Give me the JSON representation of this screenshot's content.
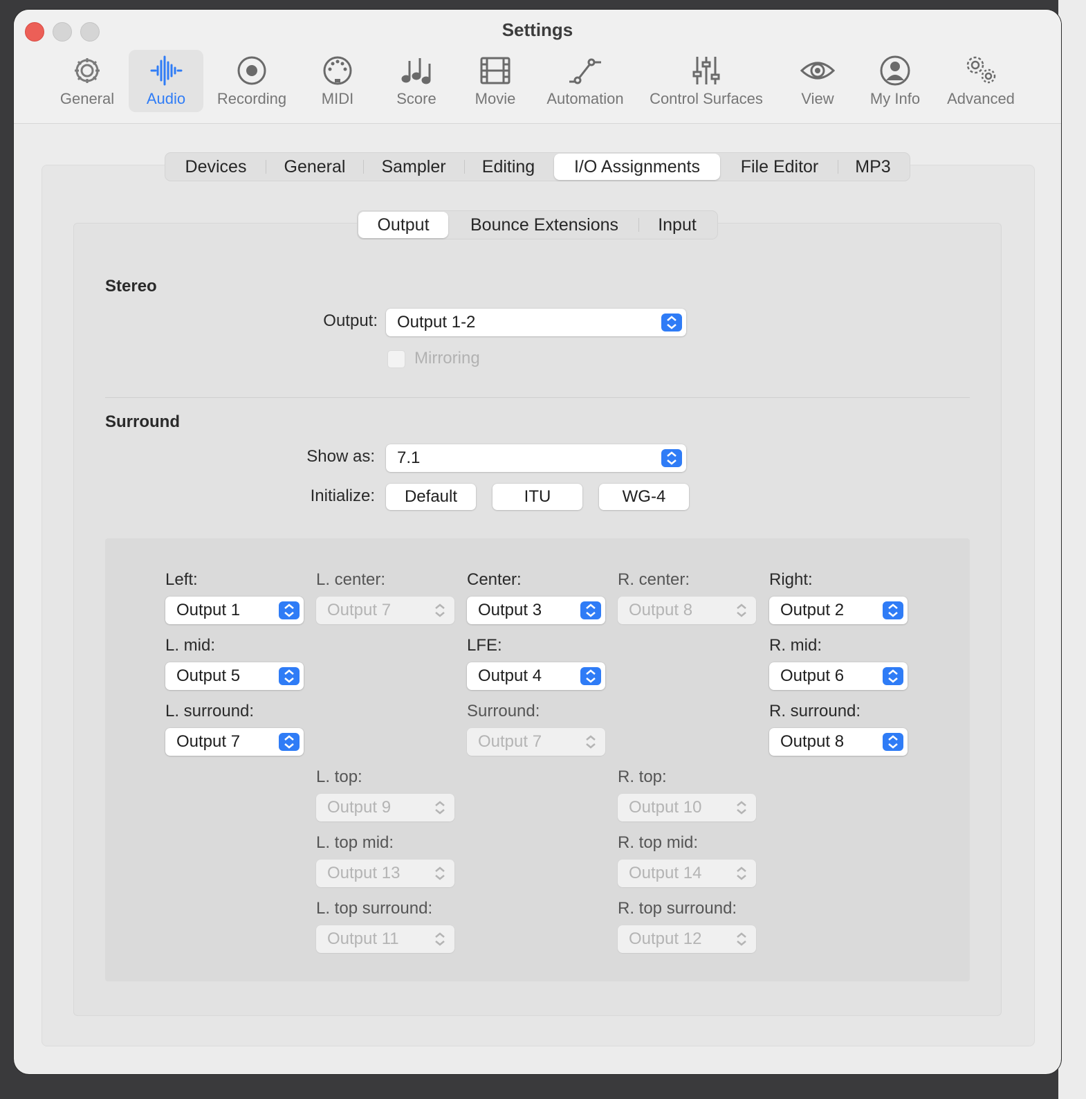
{
  "window": {
    "title": "Settings"
  },
  "toolbar": {
    "items": [
      {
        "label": "General",
        "icon": "gear-icon",
        "active": false
      },
      {
        "label": "Audio",
        "icon": "audio-waveform-icon",
        "active": true
      },
      {
        "label": "Recording",
        "icon": "record-icon",
        "active": false
      },
      {
        "label": "MIDI",
        "icon": "midi-connector-icon",
        "active": false
      },
      {
        "label": "Score",
        "icon": "music-notes-icon",
        "active": false
      },
      {
        "label": "Movie",
        "icon": "film-strip-icon",
        "active": false
      },
      {
        "label": "Automation",
        "icon": "automation-curve-icon",
        "active": false
      },
      {
        "label": "Control Surfaces",
        "icon": "faders-icon",
        "active": false
      },
      {
        "label": "View",
        "icon": "eye-icon",
        "active": false
      },
      {
        "label": "My Info",
        "icon": "person-icon",
        "active": false
      },
      {
        "label": "Advanced",
        "icon": "gears-icon",
        "active": false
      }
    ]
  },
  "tabs": [
    "Devices",
    "General",
    "Sampler",
    "Editing",
    "I/O Assignments",
    "File Editor",
    "MP3"
  ],
  "selected_tab": "I/O Assignments",
  "subtabs": [
    "Output",
    "Bounce Extensions",
    "Input"
  ],
  "selected_subtab": "Output",
  "stereo": {
    "title": "Stereo",
    "output_label": "Output:",
    "output_value": "Output 1-2",
    "mirroring_label": "Mirroring",
    "mirroring_checked": false,
    "mirroring_enabled": false
  },
  "surround": {
    "title": "Surround",
    "show_as_label": "Show as:",
    "show_as_value": "7.1",
    "initialize_label": "Initialize:",
    "init_buttons": [
      "Default",
      "ITU",
      "WG-4"
    ],
    "channels": {
      "left": {
        "label": "Left:",
        "value": "Output 1",
        "enabled": true
      },
      "l_center": {
        "label": "L. center:",
        "value": "Output 7",
        "enabled": false
      },
      "center": {
        "label": "Center:",
        "value": "Output 3",
        "enabled": true
      },
      "r_center": {
        "label": "R. center:",
        "value": "Output 8",
        "enabled": false
      },
      "right": {
        "label": "Right:",
        "value": "Output 2",
        "enabled": true
      },
      "l_mid": {
        "label": "L. mid:",
        "value": "Output 5",
        "enabled": true
      },
      "lfe": {
        "label": "LFE:",
        "value": "Output 4",
        "enabled": true
      },
      "r_mid": {
        "label": "R. mid:",
        "value": "Output 6",
        "enabled": true
      },
      "l_surround": {
        "label": "L. surround:",
        "value": "Output 7",
        "enabled": true
      },
      "surround": {
        "label": "Surround:",
        "value": "Output 7",
        "enabled": false
      },
      "r_surround": {
        "label": "R. surround:",
        "value": "Output 8",
        "enabled": true
      },
      "l_top": {
        "label": "L. top:",
        "value": "Output 9",
        "enabled": false
      },
      "r_top": {
        "label": "R. top:",
        "value": "Output 10",
        "enabled": false
      },
      "l_top_mid": {
        "label": "L. top mid:",
        "value": "Output 13",
        "enabled": false
      },
      "r_top_mid": {
        "label": "R. top mid:",
        "value": "Output 14",
        "enabled": false
      },
      "l_top_surround": {
        "label": "L. top surround:",
        "value": "Output 11",
        "enabled": false
      },
      "r_top_surround": {
        "label": "R. top surround:",
        "value": "Output 12",
        "enabled": false
      }
    }
  },
  "colors": {
    "accent": "#2f7cf6",
    "close": "#ec5f57",
    "window_bg": "#ececec"
  }
}
